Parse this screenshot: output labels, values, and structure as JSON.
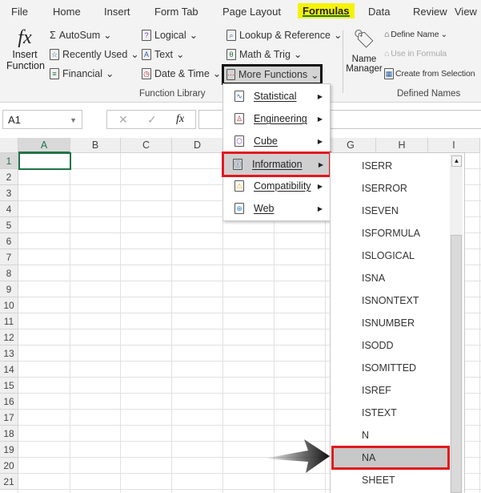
{
  "tabs": [
    "File",
    "Home",
    "Insert",
    "Form Tab",
    "Page Layout",
    "Formulas",
    "Data",
    "Review",
    "View"
  ],
  "active_tab": "Formulas",
  "ribbon": {
    "insert_function": [
      "Insert",
      "Function"
    ],
    "col1": [
      "AutoSum",
      "Recently Used",
      "Financial"
    ],
    "col2": [
      "Logical",
      "Text",
      "Date & Time"
    ],
    "col3": [
      "Lookup & Reference",
      "Math & Trig",
      "More Functions"
    ],
    "function_library": "Function Library",
    "name_manager": [
      "Name",
      "Manager"
    ],
    "defined": [
      "Define Name",
      "Use in Formula",
      "Create from Selection"
    ],
    "defined_names": "Defined Names"
  },
  "formula_bar": {
    "name_box": "A1",
    "fx": "fx",
    "cancel": "✕",
    "enter": "✓"
  },
  "columns": [
    "A",
    "B",
    "C",
    "D",
    "E",
    "F",
    "G",
    "H",
    "I"
  ],
  "rows": [
    "1",
    "2",
    "3",
    "4",
    "5",
    "6",
    "7",
    "8",
    "9",
    "10",
    "11",
    "12",
    "13",
    "14",
    "15",
    "16",
    "17",
    "18",
    "19",
    "20",
    "21"
  ],
  "more_functions_menu": [
    "Statistical",
    "Engineering",
    "Cube",
    "Information",
    "Compatibility",
    "Web"
  ],
  "highlighted_category": "Information",
  "information_functions": [
    "ISERR",
    "ISERROR",
    "ISEVEN",
    "ISFORMULA",
    "ISLOGICAL",
    "ISNA",
    "ISNONTEXT",
    "ISNUMBER",
    "ISODD",
    "ISOMITTED",
    "ISREF",
    "ISTEXT",
    "N",
    "NA",
    "SHEET"
  ],
  "highlighted_function": "NA",
  "colors": {
    "highlight_yellow": "#f5f20a",
    "excel_green": "#217346",
    "callout_red": "#e0191e"
  }
}
